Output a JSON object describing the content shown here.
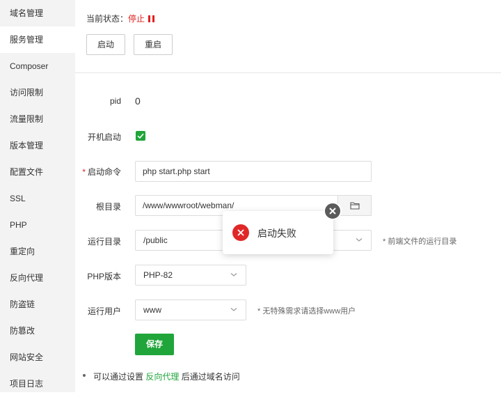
{
  "sidebar": {
    "items": [
      {
        "label": "域名管理"
      },
      {
        "label": "服务管理"
      },
      {
        "label": "Composer"
      },
      {
        "label": "访问限制"
      },
      {
        "label": "流量限制"
      },
      {
        "label": "版本管理"
      },
      {
        "label": "配置文件"
      },
      {
        "label": "SSL"
      },
      {
        "label": "PHP"
      },
      {
        "label": "重定向"
      },
      {
        "label": "反向代理"
      },
      {
        "label": "防盗链"
      },
      {
        "label": "防篡改"
      },
      {
        "label": "网站安全"
      },
      {
        "label": "项目日志"
      }
    ]
  },
  "status": {
    "label": "当前状态：",
    "value": "停止",
    "color": "#e02020"
  },
  "actions": {
    "start": "启动",
    "restart": "重启"
  },
  "form": {
    "pid": {
      "label": "pid",
      "value": "0"
    },
    "autostart": {
      "label": "开机启动",
      "checked": true
    },
    "command": {
      "required_mark": "*",
      "label": "启动命令",
      "value": "php start.php start"
    },
    "root_dir": {
      "label": "根目录",
      "value": "/www/wwwroot/webman/",
      "icon": "folder-icon"
    },
    "run_dir": {
      "label": "运行目录",
      "value": "/public",
      "hint": "* 前端文件的运行目录"
    },
    "php_version": {
      "label": "PHP版本",
      "value": "PHP-82"
    },
    "run_user": {
      "label": "运行用户",
      "value": "www",
      "hint": "* 无特殊需求请选择www用户"
    },
    "save": "保存"
  },
  "note": {
    "prefix": "可以通过设置",
    "link": "反向代理",
    "suffix": "后通过域名访问"
  },
  "toast": {
    "message": "启动失败",
    "icon": "error-icon"
  },
  "colors": {
    "accent": "#20a53a",
    "danger": "#e02020",
    "sidebar_bg": "#f3f3f3"
  }
}
